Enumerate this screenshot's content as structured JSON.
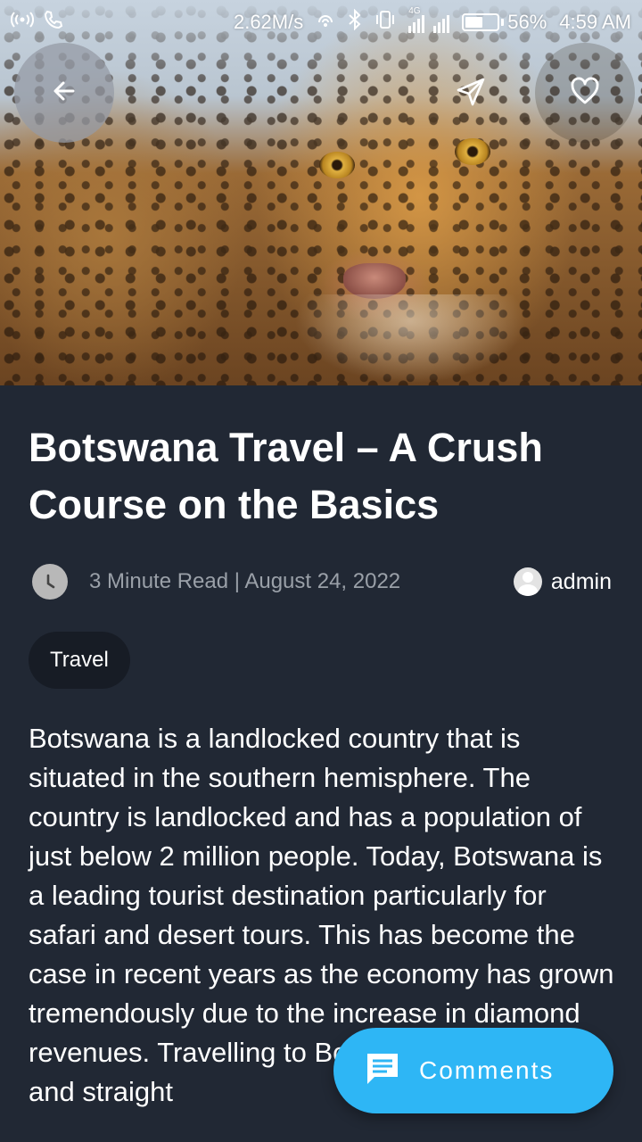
{
  "status_bar": {
    "network_speed": "2.62M/s",
    "network_type": "4G",
    "battery_percent": "56%",
    "battery_level": 0.56,
    "time": "4:59 AM",
    "icons": [
      "hotspot-icon",
      "call-icon",
      "sync-icon",
      "bluetooth-icon",
      "vibrate-icon",
      "signal-icon"
    ]
  },
  "header": {
    "back_icon": "arrow-left-icon",
    "share_icon": "send-icon",
    "favorite_icon": "heart-outline-icon",
    "hero_image": "leopard-photo"
  },
  "article": {
    "title": "Botswana Travel – A Crush Course on the Basics",
    "read_info": "3 Minute Read | August 24, 2022",
    "author": "admin",
    "category": "Travel",
    "body": "Botswana is a landlocked country that is situated in the southern hemisphere. The country is landlocked and has a population of just below 2 million people. Today, Botswana is a leading tourist destination particularly for safari and desert tours. This has become the case in recent years as the economy has grown tremendously due to the increase in diamond revenues. Travelling to Botswana is fairly easy and straight"
  },
  "fab": {
    "label": "Comments",
    "icon": "comment-icon",
    "color": "#2eb6f5"
  },
  "colors": {
    "background": "#212834",
    "chip_background": "#171c25",
    "meta_text": "#9aa0a8"
  }
}
